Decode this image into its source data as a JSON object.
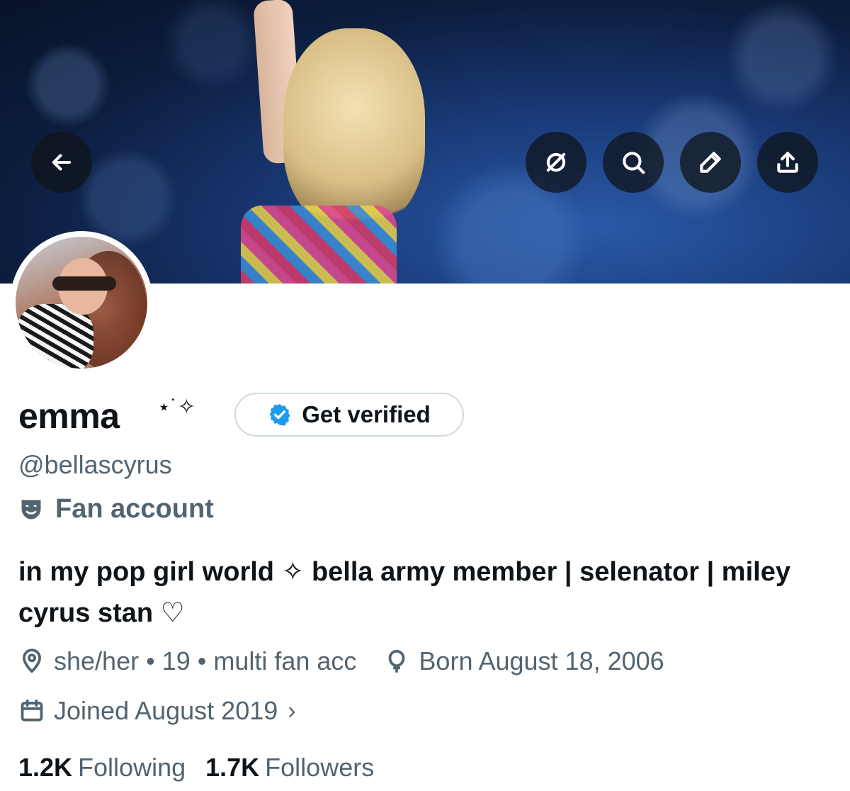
{
  "header": {
    "back_icon": "arrow-left-icon",
    "actions": [
      "hide-icon",
      "search-icon",
      "edit-pencil-icon",
      "share-icon"
    ]
  },
  "profile": {
    "display_name": "emma",
    "name_decoration": "⋆˙✧",
    "verify_button": "Get verified",
    "handle": "@bellascyrus",
    "category": "Fan account",
    "bio": "in my pop girl world ✧ bella army member | selenator | miley cyrus stan ♡",
    "location": "she/her • 19 • multi fan acc",
    "birthday": "Born August 18, 2006",
    "joined": "Joined August 2019",
    "following_count": "1.2K",
    "following_label": "Following",
    "followers_count": "1.7K",
    "followers_label": "Followers"
  },
  "colors": {
    "text_primary": "#0f1419",
    "text_secondary": "#536471",
    "verified_blue": "#1d9bf0",
    "border": "#cfd9de"
  }
}
